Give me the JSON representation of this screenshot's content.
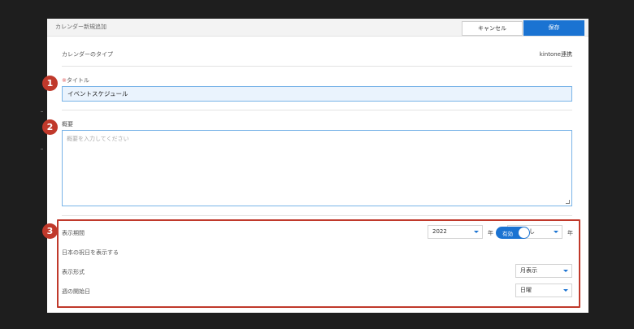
{
  "header": {
    "title": "カレンダー新規追加",
    "cancel_label": "キャンセル",
    "save_label": "保存"
  },
  "calendar_type": {
    "label": "カレンダーのタイプ",
    "value": "kintone連携"
  },
  "title_field": {
    "required_mark": "※",
    "label": "タイトル",
    "value": "イベントスケジュール"
  },
  "summary_field": {
    "label": "概要",
    "placeholder": "概要を入力してください"
  },
  "display_period": {
    "label": "表示期間",
    "start_year": "2022",
    "year_unit_1": "年",
    "tilde": "〜",
    "end_value": "設定なし",
    "year_unit_2": "年"
  },
  "holidays": {
    "label": "日本の祝日を表示する",
    "toggle_label": "有効"
  },
  "display_format": {
    "label": "表示形式",
    "value": "月表示"
  },
  "week_start": {
    "label": "週の開始日",
    "value": "日曜"
  },
  "badges": [
    "1",
    "2",
    "3"
  ]
}
